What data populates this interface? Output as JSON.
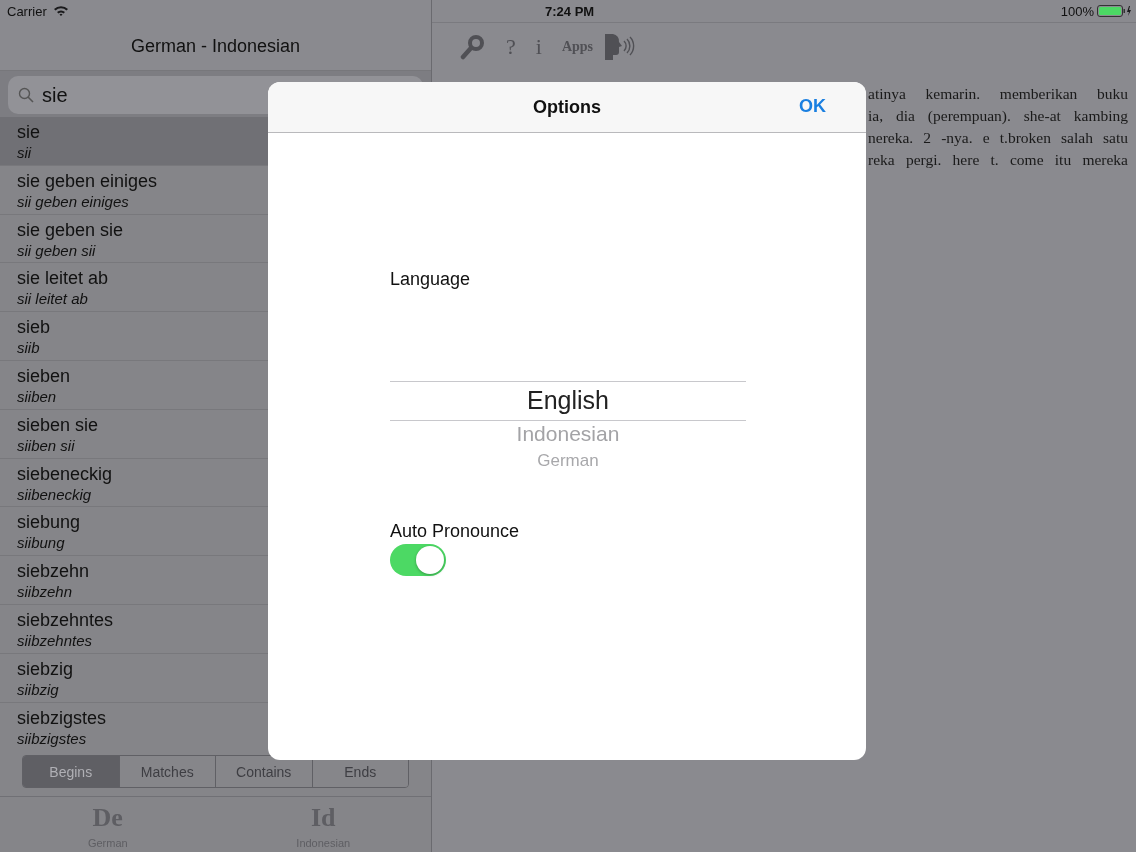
{
  "status_bar": {
    "carrier": "Carrier",
    "time": "7:24 PM",
    "battery": "100%"
  },
  "sidebar": {
    "title": "German - Indonesian",
    "search": {
      "value": "sie"
    },
    "items": [
      {
        "word": "sie",
        "reading": "sii",
        "selected": true
      },
      {
        "word": "sie geben einiges",
        "reading": "sii geben einiges",
        "selected": false
      },
      {
        "word": "sie geben sie",
        "reading": "sii geben sii",
        "selected": false
      },
      {
        "word": "sie leitet ab",
        "reading": "sii leitet ab",
        "selected": false
      },
      {
        "word": "sieb",
        "reading": "siib",
        "selected": false
      },
      {
        "word": "sieben",
        "reading": "siiben",
        "selected": false
      },
      {
        "word": "sieben sie",
        "reading": "siiben sii",
        "selected": false
      },
      {
        "word": "siebeneckig",
        "reading": "siibeneckig",
        "selected": false
      },
      {
        "word": "siebung",
        "reading": "siibung",
        "selected": false
      },
      {
        "word": "siebzehn",
        "reading": "siibzehn",
        "selected": false
      },
      {
        "word": "siebzehntes",
        "reading": "siibzehntes",
        "selected": false
      },
      {
        "word": "siebzig",
        "reading": "siibzig",
        "selected": false
      },
      {
        "word": "siebzigstes",
        "reading": "siibzigstes",
        "selected": false
      }
    ],
    "match_modes": [
      {
        "label": "Begins",
        "selected": true
      },
      {
        "label": "Matches",
        "selected": false
      },
      {
        "label": "Contains",
        "selected": false
      },
      {
        "label": "Ends",
        "selected": false
      }
    ],
    "tabs": [
      {
        "code": "De",
        "label": "German"
      },
      {
        "code": "Id",
        "label": "Indonesian"
      }
    ]
  },
  "toolbar": {
    "help": "?",
    "info": "i",
    "apps": "Apps"
  },
  "content_lines": [
    "atinya kemarin. memberikan buku",
    "ia, dia (perempuan). she-at kambing",
    "nereka. 2 -nya. e t.broken salah satu",
    "reka pergi. here t. come itu mereka"
  ],
  "dialog": {
    "title": "Options",
    "ok": "OK",
    "language_label": "Language",
    "languages": [
      {
        "name": "English",
        "selected": true
      },
      {
        "name": "Indonesian",
        "selected": false
      },
      {
        "name": "German",
        "selected": false
      }
    ],
    "auto_pronounce": {
      "label": "Auto Pronounce",
      "on": true
    }
  }
}
